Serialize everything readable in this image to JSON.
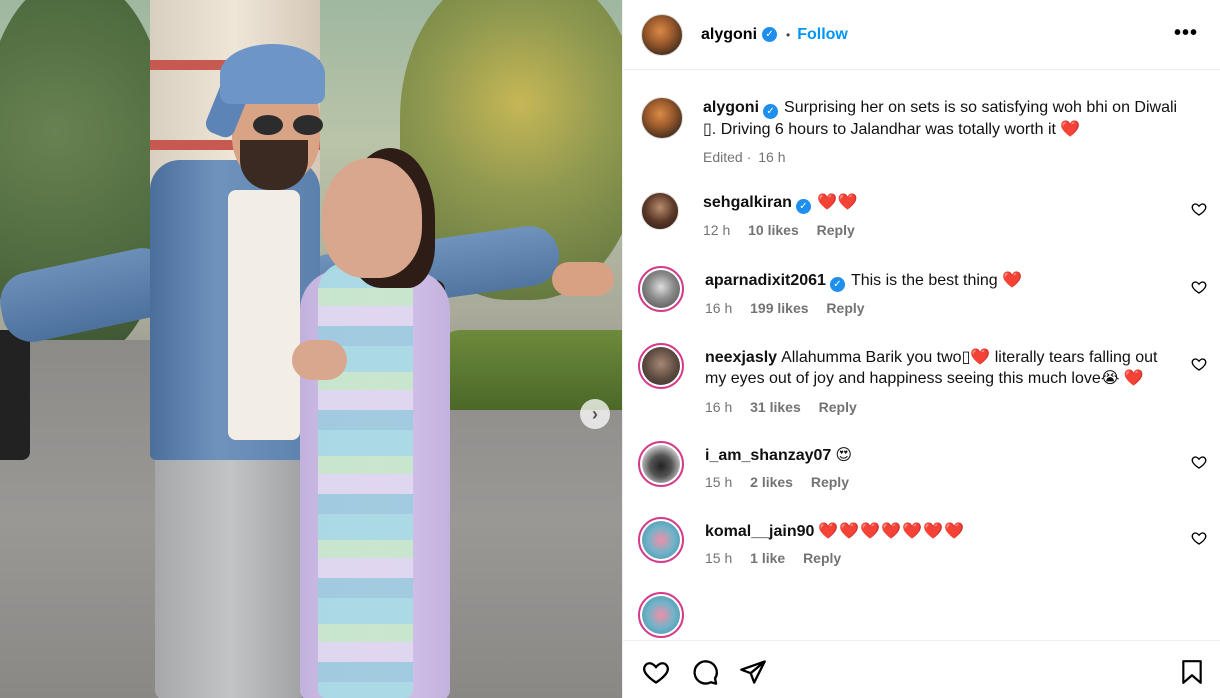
{
  "post": {
    "username": "alygoni",
    "follow_label": "Follow",
    "dot": "•",
    "more_label": "•••",
    "caption_line1": "Surprising her on sets is so satisfying woh bhi on Diwali",
    "caption_line2": "▯. Driving 6 hours to Jalandhar was totally worth it ❤️",
    "edited": "Edited",
    "time": "16 h"
  },
  "comments": [
    {
      "username": "sehgalkiran",
      "text": "❤️❤️",
      "time": "12 h",
      "likes": "10 likes",
      "reply": "Reply",
      "verified": true
    },
    {
      "username": "aparnadixit2061",
      "text": "This is the best thing ❤️",
      "time": "16 h",
      "likes": "199 likes",
      "reply": "Reply",
      "verified": true
    },
    {
      "username": "neexjasly",
      "text": "Allahumma Barik you two▯❤️ literally tears falling out my eyes out of joy and happiness seeing this much love😭 ❤️",
      "time": "16 h",
      "likes": "31 likes",
      "reply": "Reply",
      "verified": false
    },
    {
      "username": "i_am_shanzay07",
      "text": "😍",
      "time": "15 h",
      "likes": "2 likes",
      "reply": "Reply",
      "verified": false
    },
    {
      "username": "komal__jain90",
      "text": "❤️❤️❤️❤️❤️❤️❤️",
      "time": "15 h",
      "likes": "1 like",
      "reply": "Reply",
      "verified": false
    }
  ],
  "nav": {
    "next_glyph": "›"
  },
  "colors": {
    "follow": "#0095f6",
    "verified": "#1f8fef",
    "heart": "#e0142f",
    "meta": "#737373"
  },
  "icons": [
    "heart-icon",
    "comment-icon",
    "share-icon",
    "bookmark-icon",
    "more-icon",
    "verified-icon",
    "next-arrow-icon"
  ]
}
